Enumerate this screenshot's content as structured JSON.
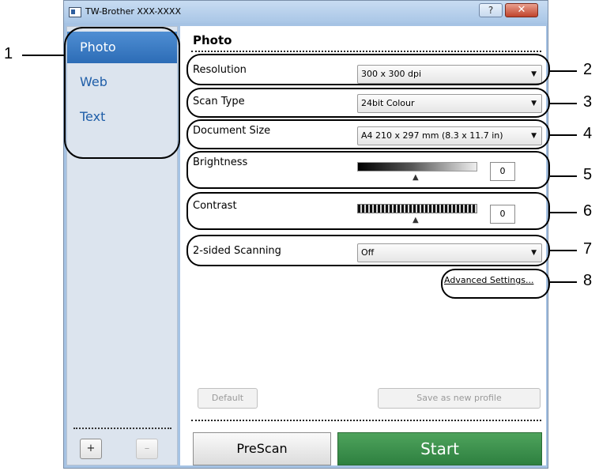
{
  "window": {
    "title": "TW-Brother XXX-XXXX",
    "help_button": "?",
    "close_button": "✕"
  },
  "sidebar": {
    "items": [
      {
        "label": "Photo",
        "selected": true
      },
      {
        "label": "Web",
        "selected": false
      },
      {
        "label": "Text",
        "selected": false
      }
    ],
    "add_button": "+",
    "remove_button": "–"
  },
  "panel": {
    "heading": "Photo",
    "resolution": {
      "label": "Resolution",
      "value": "300 x 300 dpi"
    },
    "scan_type": {
      "label": "Scan Type",
      "value": "24bit Colour"
    },
    "document_size": {
      "label": "Document Size",
      "value": "A4 210 x 297 mm (8.3 x 11.7 in)"
    },
    "brightness": {
      "label": "Brightness",
      "value": "0"
    },
    "contrast": {
      "label": "Contrast",
      "value": "0"
    },
    "two_sided": {
      "label": "2-sided Scanning",
      "value": "Off"
    },
    "advanced_link": "Advanced Settings...",
    "default_button": "Default",
    "save_profile_button": "Save as new profile",
    "prescan_button": "PreScan",
    "start_button": "Start"
  },
  "callouts": [
    "1",
    "2",
    "3",
    "4",
    "5",
    "6",
    "7",
    "8"
  ],
  "colors": {
    "sidebar_selected": "#2c6cb6",
    "start_button": "#2e8040",
    "link_text": "#1f5ea8"
  }
}
